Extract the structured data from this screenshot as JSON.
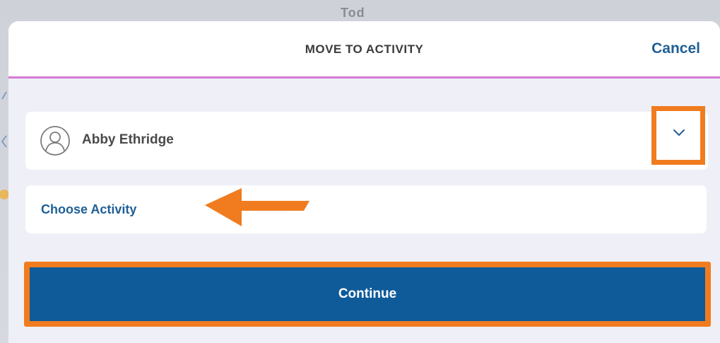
{
  "backdrop": {
    "ghost_text": "Tod"
  },
  "modal": {
    "title": "MOVE TO ACTIVITY",
    "cancel_label": "Cancel"
  },
  "person": {
    "name": "Abby Ethridge",
    "avatar_icon": "person-avatar-icon",
    "expand_icon": "chevron-down-icon"
  },
  "activity": {
    "label": "Choose Activity"
  },
  "actions": {
    "continue_label": "Continue"
  },
  "colors": {
    "accent_blue": "#1f5f96",
    "button_blue": "#0f5b9a",
    "highlight_orange": "#f07c1f",
    "header_divider": "#d67ad6",
    "modal_bg": "#efeff7"
  },
  "annotations": {
    "arrow_icon": "left-arrow-annotation-icon"
  }
}
